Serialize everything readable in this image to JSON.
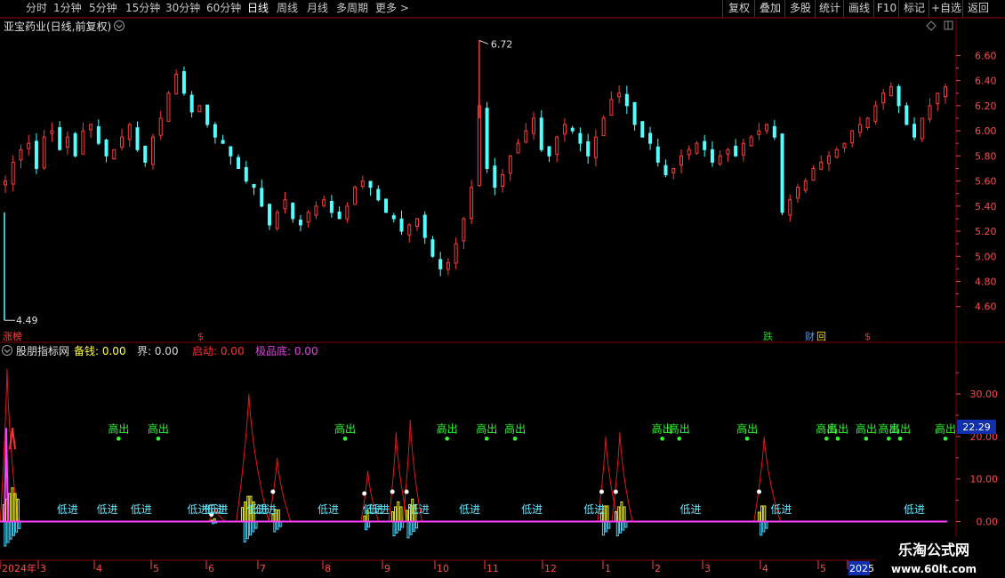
{
  "toolbar": {
    "periods": [
      "分时",
      "1分钟",
      "5分钟",
      "15分钟",
      "30分钟",
      "60分钟",
      "日线",
      "周线",
      "月线",
      "多周期",
      "更多 >"
    ],
    "active_period": "日线",
    "actions": [
      "复权",
      "叠加",
      "多股",
      "统计",
      "画线",
      "F10",
      "标记",
      "+自选",
      "返回"
    ]
  },
  "main_panel": {
    "title": "亚宝药业(日线,前复权)",
    "high_label": "6.72",
    "low_label": "4.49",
    "markers": [
      {
        "text": "涨榜",
        "color": "#ff4040"
      },
      {
        "text": "$",
        "color": "#ff3030"
      },
      {
        "text": "跌",
        "color": "#00e000"
      },
      {
        "text": "财",
        "color": "#40a0ff"
      },
      {
        "text": "回",
        "color": "#ffd000"
      },
      {
        "text": "$",
        "color": "#ff3030"
      }
    ]
  },
  "indicator_panel": {
    "name": "股朋指标网",
    "fields": [
      {
        "label": "备钱:",
        "value": "0.00",
        "color": "#ffff40"
      },
      {
        "label": "界:",
        "value": "0.00",
        "color": "#d8d8d8"
      },
      {
        "label": "启动:",
        "value": "0.00",
        "color": "#ff3030"
      },
      {
        "label": "极品底:",
        "value": "0.00",
        "color": "#e040e0"
      }
    ],
    "current_value": "22.29",
    "signal_high": "高出",
    "signal_low": "低进"
  },
  "time_axis": {
    "labels": [
      "2024年",
      "3",
      "4",
      "5",
      "6",
      "7",
      "8",
      "9",
      "10",
      "11",
      "12",
      "1",
      "2",
      "3",
      "4",
      "5",
      "2025"
    ]
  },
  "watermark": {
    "title": "乐淘公式网",
    "url": "www.60lt.com"
  },
  "colors": {
    "up": "#ff3b3b",
    "down": "#54ffff",
    "frame": "#800000",
    "grid": "#5a0000",
    "axis": "#ff4040"
  },
  "chart_data": [
    {
      "type": "candlestick",
      "title": "亚宝药业(日线,前复权)",
      "ylim": [
        4.35,
        6.78
      ],
      "yticks": [
        4.6,
        4.8,
        5.0,
        5.2,
        5.4,
        5.6,
        5.8,
        6.0,
        6.2,
        6.4,
        6.6
      ],
      "high_mark": 6.72,
      "low_mark": 4.49,
      "close_series": [
        5.6,
        5.75,
        5.85,
        5.9,
        5.7,
        5.95,
        6.0,
        5.85,
        5.95,
        5.8,
        6.0,
        6.05,
        5.9,
        5.8,
        5.85,
        5.95,
        6.05,
        5.85,
        5.75,
        5.95,
        6.1,
        6.3,
        6.45,
        6.3,
        6.15,
        6.2,
        6.05,
        5.95,
        5.9,
        5.8,
        5.7,
        5.6,
        5.55,
        5.4,
        5.25,
        5.35,
        5.45,
        5.3,
        5.25,
        5.35,
        5.4,
        5.45,
        5.35,
        5.3,
        5.4,
        5.55,
        5.6,
        5.55,
        5.45,
        5.35,
        5.3,
        5.2,
        5.25,
        5.3,
        5.15,
        5.0,
        4.9,
        4.95,
        5.1,
        5.3,
        5.55,
        6.2,
        5.7,
        5.55,
        5.65,
        5.8,
        5.9,
        6.0,
        6.1,
        5.85,
        5.8,
        5.95,
        6.05,
        6.0,
        5.9,
        5.8,
        5.95,
        6.1,
        6.25,
        6.3,
        6.2,
        6.05,
        5.95,
        5.9,
        5.75,
        5.65,
        5.7,
        5.8,
        5.85,
        5.9,
        5.85,
        5.75,
        5.8,
        5.85,
        5.8,
        5.9,
        5.95,
        6.0,
        6.05,
        5.95,
        5.35,
        5.45,
        5.55,
        5.6,
        5.7,
        5.75,
        5.8,
        5.85,
        5.9,
        6.0,
        6.05,
        6.1,
        6.2,
        6.3,
        6.35,
        6.2,
        6.05,
        5.95,
        6.1,
        6.2,
        6.3,
        6.35
      ]
    },
    {
      "type": "line",
      "title": "股朋指标网",
      "ylim": [
        -7,
        39
      ],
      "yticks": [
        0.0,
        10.0,
        20.0,
        30.0
      ],
      "spikes": [
        {
          "x": 0.3,
          "value": 36,
          "width": 1.2
        },
        {
          "x": 37,
          "value": 3,
          "width": 1.2
        },
        {
          "x": 43,
          "value": 30,
          "width": 2.2
        },
        {
          "x": 48,
          "value": 15,
          "width": 1.5
        },
        {
          "x": 64,
          "value": 12,
          "width": 1.2
        },
        {
          "x": 69,
          "value": 21,
          "width": 1.3
        },
        {
          "x": 71.5,
          "value": 24,
          "width": 1.3
        },
        {
          "x": 106,
          "value": 20,
          "width": 1.4
        },
        {
          "x": 108.5,
          "value": 21,
          "width": 1.4
        },
        {
          "x": 134,
          "value": 20,
          "width": 1.8
        }
      ],
      "high_signals_x": [
        20,
        27,
        60,
        78,
        85,
        90,
        116,
        119,
        131,
        145,
        147,
        152,
        156,
        158,
        166
      ],
      "high_signal_value": 22,
      "low_signals_x": [
        11,
        18,
        24,
        34,
        37,
        37.5,
        44.5,
        46,
        57,
        65,
        66,
        73,
        82,
        93,
        104,
        121,
        137,
        160.5
      ],
      "low_signal_value": 3,
      "current_value": 22.29
    }
  ]
}
